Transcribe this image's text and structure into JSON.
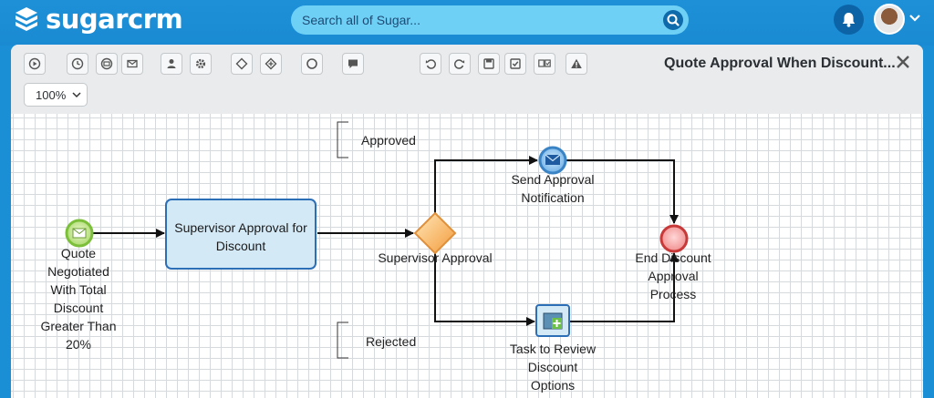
{
  "app": {
    "logo_text": "sugarcrm"
  },
  "search": {
    "placeholder": "Search all of Sugar..."
  },
  "designer": {
    "title": "Quote Approval When Discount...",
    "zoom": "100%",
    "toolbar_icons": [
      "play-icon",
      "clock-icon",
      "inbox-icon",
      "mail-icon",
      "user-icon",
      "gear-icon",
      "diamond-icon",
      "plus-diamond-icon",
      "circle-icon",
      "comment-icon",
      "undo-icon",
      "redo-icon",
      "save-icon",
      "check-icon",
      "import-export-icon",
      "warning-icon"
    ]
  },
  "diagram": {
    "start_event": {
      "label": [
        "Quote",
        "Negotiated",
        "With Total",
        "Discount",
        "Greater Than",
        "20%"
      ]
    },
    "user_task": {
      "label": [
        "Supervisor Approval for",
        "Discount"
      ]
    },
    "gateway": {
      "label": "Supervisor Approval"
    },
    "message_event": {
      "label": [
        "Send Approval",
        "Notification"
      ]
    },
    "script_task": {
      "label": [
        "Task to Review",
        "Discount",
        "Options"
      ]
    },
    "end_event": {
      "label": [
        "End Discount",
        "Approval",
        "Process"
      ]
    },
    "annotation_approved": "Approved",
    "annotation_rejected": "Rejected"
  },
  "colors": {
    "brand": "#1a8fd6",
    "search_bg": "#6fd0f6",
    "task_border": "#2d6fb7",
    "task_fill": "#d4e9f6"
  }
}
